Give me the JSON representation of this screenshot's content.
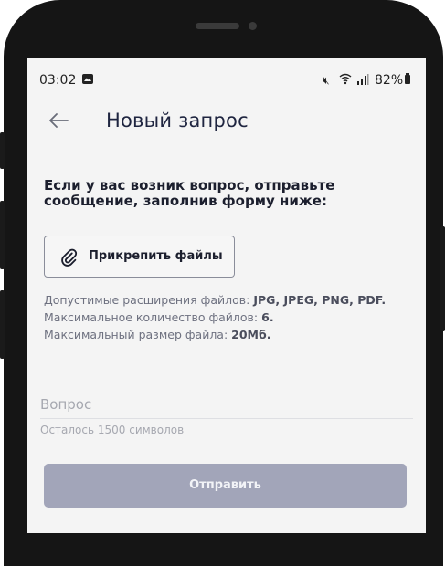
{
  "status_bar": {
    "time": "03:02",
    "battery": "82%"
  },
  "header": {
    "title": "Новый запрос"
  },
  "form": {
    "intro_line1": "Если у вас возник вопрос, отправьте",
    "intro_line2": "сообщение, заполнив форму ниже:",
    "attach_label": "Прикрепить файлы",
    "info": {
      "extensions_prefix": "Допустимые расширения файлов: ",
      "extensions_value": "JPG, JPEG, PNG, PDF.",
      "count_prefix": "Максимальное количество файлов: ",
      "count_value": "6.",
      "size_prefix": "Максимальный размер файла: ",
      "size_value": "20Мб."
    },
    "question_placeholder": "Вопрос",
    "chars_left": "Осталось 1500 символов",
    "submit_label": "Отправить"
  },
  "colors": {
    "accent_disabled": "#a2a5b9",
    "title_text": "#1f2540"
  },
  "icons": [
    "gallery-icon",
    "mute-icon",
    "wifi-icon",
    "signal-icon",
    "battery-icon",
    "back-arrow-icon",
    "paperclip-icon"
  ]
}
